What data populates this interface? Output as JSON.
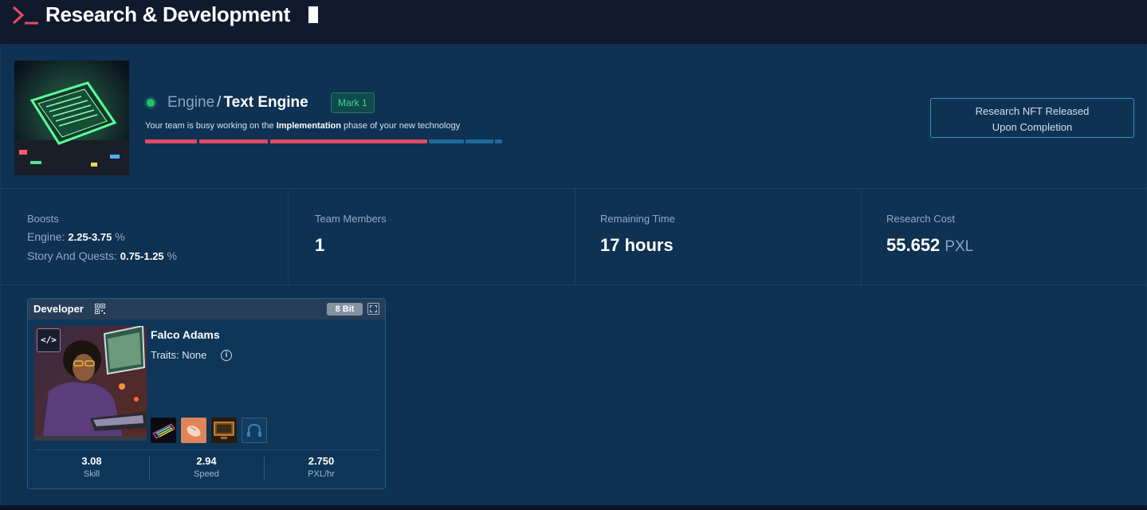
{
  "header": {
    "title": "Research & Development"
  },
  "project": {
    "image_name": "text-engine-chip-illustration",
    "category": "Engine",
    "separator": "/",
    "name": "Text Engine",
    "mark": "Mark 1",
    "status_prefix": "Your team is busy working on the ",
    "phase": "Implementation",
    "status_suffix": " phase of your new technology",
    "progress": {
      "segments": [
        {
          "state": "done",
          "color": "#e04a62"
        },
        {
          "state": "done",
          "color": "#e04a62"
        },
        {
          "state": "done",
          "color": "#e04a62"
        },
        {
          "state": "pending",
          "color": "#1f6a9a"
        },
        {
          "state": "pending",
          "color": "#1f6a9a"
        },
        {
          "state": "pending",
          "color": "#1f6a9a"
        }
      ]
    },
    "nft_button_line1": "Research NFT Released",
    "nft_button_line2": "Upon Completion"
  },
  "stats": {
    "boosts": {
      "label": "Boosts",
      "items": [
        {
          "name": "Engine:",
          "value": "2.25-3.75",
          "unit": "%"
        },
        {
          "name": "Story And Quests:",
          "value": "0.75-1.25",
          "unit": "%"
        }
      ]
    },
    "team_members": {
      "label": "Team Members",
      "value": "1"
    },
    "remaining_time": {
      "label": "Remaining Time",
      "value": "17 hours"
    },
    "research_cost": {
      "label": "Research Cost",
      "value": "55.652",
      "unit": "PXL"
    }
  },
  "developer": {
    "role": "Developer",
    "tier": "8 Bit",
    "role_tag": "</>",
    "name": "Falco Adams",
    "traits": "Traits: None",
    "info_glyph": "i",
    "equipment": [
      {
        "name": "keyboard-item",
        "filled": true
      },
      {
        "name": "mouse-item",
        "filled": true
      },
      {
        "name": "monitor-item",
        "filled": true
      },
      {
        "name": "headphones-slot",
        "filled": false
      }
    ],
    "metrics": [
      {
        "value": "3.08",
        "label": "Skill"
      },
      {
        "value": "2.94",
        "label": "Speed"
      },
      {
        "value": "2.750",
        "label": "PXL/hr"
      }
    ]
  },
  "colors": {
    "accent_red": "#e04a62",
    "status_green": "#22c070",
    "panel_bg": "#0f3152",
    "header_bg": "#111a2c"
  }
}
